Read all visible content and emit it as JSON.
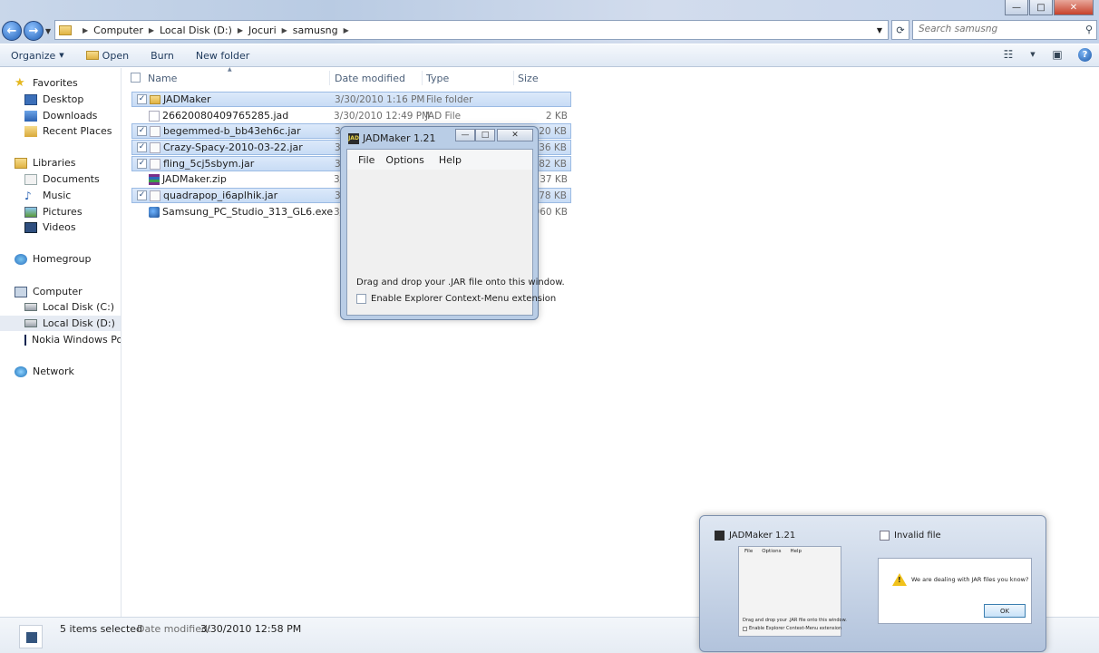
{
  "window": {
    "caption": {
      "minimize": "—",
      "maximize": "□",
      "close": "✕"
    },
    "nav": {
      "back": "←",
      "forward": "→"
    }
  },
  "address_bar": {
    "crumbs": [
      "Computer",
      "Local Disk (D:)",
      "Jocuri",
      "samusng"
    ],
    "search_placeholder": "Search samusng"
  },
  "toolbar": {
    "organize": "Organize",
    "open": "Open",
    "burn": "Burn",
    "new_folder": "New folder"
  },
  "nav_pane": {
    "favorites": "Favorites",
    "desktop": "Desktop",
    "downloads": "Downloads",
    "recent_places": "Recent Places",
    "libraries": "Libraries",
    "documents": "Documents",
    "music": "Music",
    "pictures": "Pictures",
    "videos": "Videos",
    "homegroup": "Homegroup",
    "computer": "Computer",
    "disk_c": "Local Disk (C:)",
    "disk_d": "Local Disk (D:)",
    "nokia": "Nokia Windows Port",
    "network": "Network"
  },
  "columns": {
    "name": "Name",
    "date": "Date modified",
    "type": "Type",
    "size": "Size"
  },
  "files": [
    {
      "name": "JADMaker",
      "date": "3/30/2010 1:16 PM",
      "type": "File folder",
      "size": "",
      "selected": true,
      "icon": "folder-icon"
    },
    {
      "name": "26620080409765285.jad",
      "date": "3/30/2010 12:49 PM",
      "type": "JAD File",
      "size": "2 KB",
      "selected": false,
      "icon": "jad-file-icon"
    },
    {
      "name": "begemmed-b_bb43eh6c.jar",
      "date": "3/",
      "type": "",
      "size": "120 KB",
      "selected": true,
      "icon": "jar-file-icon"
    },
    {
      "name": "Crazy-Spacy-2010-03-22.jar",
      "date": "3/",
      "type": "",
      "size": "136 KB",
      "selected": true,
      "icon": "jar-file-icon"
    },
    {
      "name": "fling_5cj5sbym.jar",
      "date": "3/",
      "type": "",
      "size": "182 KB",
      "selected": true,
      "icon": "jar-file-icon"
    },
    {
      "name": "JADMaker.zip",
      "date": "3/",
      "type": "",
      "size": "37 KB",
      "selected": false,
      "icon": "zip-archive-icon"
    },
    {
      "name": "quadrapop_i6aplhik.jar",
      "date": "3/",
      "type": "",
      "size": "78 KB",
      "selected": true,
      "icon": "jar-file-icon"
    },
    {
      "name": "Samsung_PC_Studio_313_GL6.exe",
      "date": "3/",
      "type": "",
      "size": "060 KB",
      "selected": false,
      "icon": "exe-file-icon"
    }
  ],
  "jadmaker": {
    "title": "JADMaker 1.21",
    "menu": [
      "File",
      "Options",
      "Help"
    ],
    "drop_text": "Drag and drop your .JAR file onto this window.",
    "checkbox_label": "Enable Explorer Context-Menu extension"
  },
  "status": {
    "count": "5 items selected",
    "date_label": "Date modified:",
    "date_value": "3/30/2010 12:58 PM"
  },
  "taskbar_preview": {
    "app1_title": "JADMaker 1.21",
    "app2_title": "Invalid file",
    "mini_menu": [
      "File",
      "Options",
      "Help"
    ],
    "mini_drop_text": "Drag and drop your .JAR file onto this window.",
    "mini_checkbox": "Enable Explorer Context-Menu extension",
    "dialog_message": "We are dealing with JAR files you know?",
    "ok_label": "OK"
  }
}
